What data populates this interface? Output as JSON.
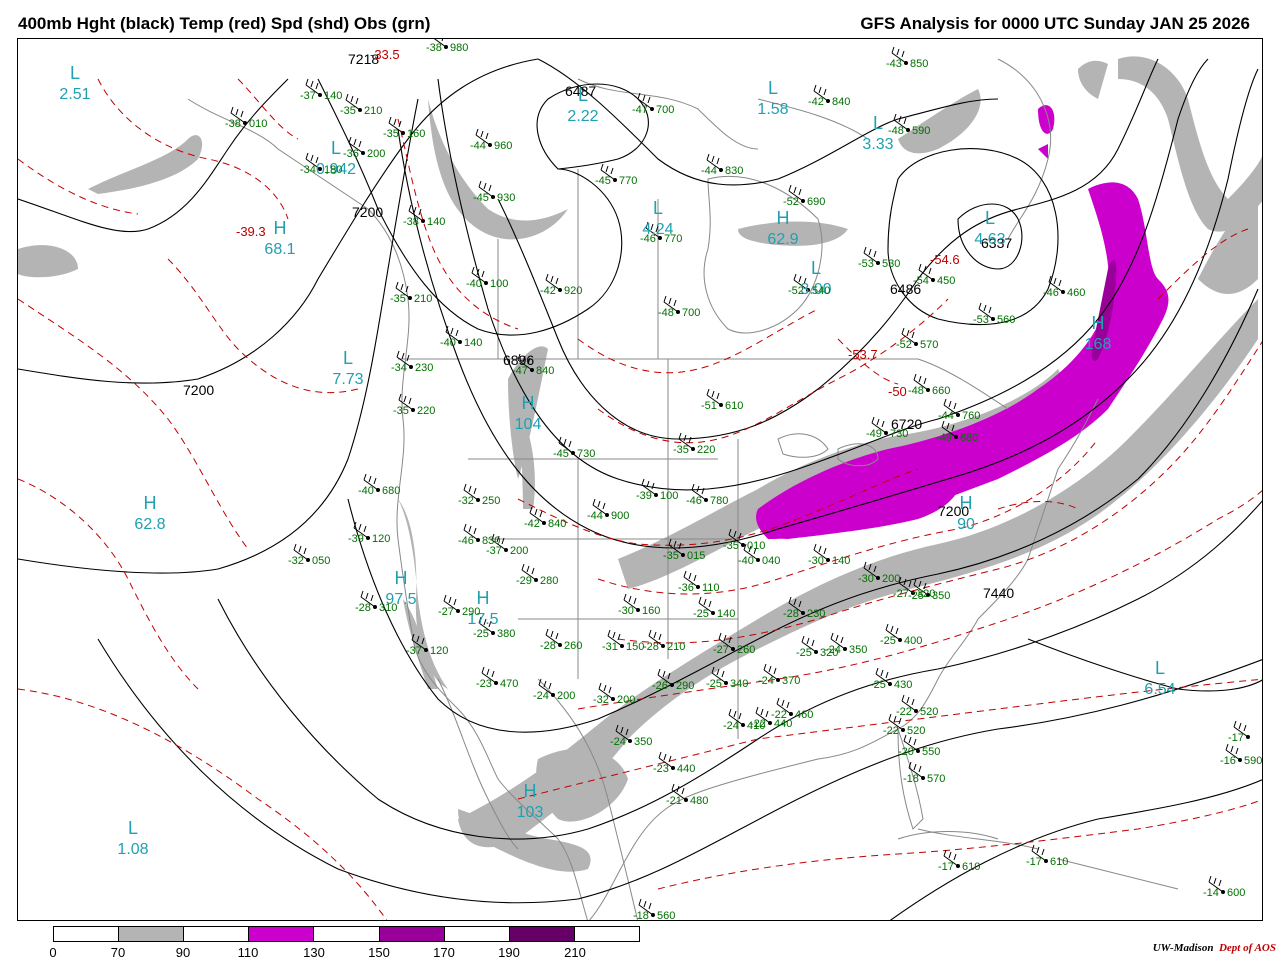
{
  "header": {
    "title_left": "400mb Hght (black) Temp (red) Spd (shd) Obs (grn)",
    "title_right": "GFS Analysis for 0000 UTC Sunday  JAN 25 2026"
  },
  "colors": {
    "height": "#000000",
    "temperature": "#c00000",
    "observation": "#007000",
    "center": "#20a0b0",
    "speed_70": "#b4b4b4",
    "speed_110": "#cc00cc",
    "speed_150": "#990099",
    "speed_190": "#660066",
    "map_lines": "#888888"
  },
  "height_labels": [
    "7218",
    "6487",
    "7200",
    "7200",
    "6896",
    "6337",
    "6486",
    "6720",
    "7200",
    "7440"
  ],
  "temperature_labels": [
    "-33.5",
    "-39.3",
    "-54.6",
    "-53.7",
    "-50"
  ],
  "centers": [
    {
      "type": "L",
      "value": "2.51"
    },
    {
      "type": "L",
      "value": "2.22"
    },
    {
      "type": "H",
      "value": ""
    },
    {
      "type": "L",
      "value": "1.58"
    },
    {
      "type": "L",
      "value": "3.33"
    },
    {
      "type": "L",
      "value": "0.942"
    },
    {
      "type": "H",
      "value": "68.1"
    },
    {
      "type": "L",
      "value": "4.24"
    },
    {
      "type": "H",
      "value": "62.9"
    },
    {
      "type": "L",
      "value": "4.63"
    },
    {
      "type": "L",
      "value": "3.00"
    },
    {
      "type": "L",
      "value": "7.73"
    },
    {
      "type": "H",
      "value": "104"
    },
    {
      "type": "H",
      "value": "168"
    },
    {
      "type": "H",
      "value": "62.8"
    },
    {
      "type": "H",
      "value": "90"
    },
    {
      "type": "H",
      "value": "97.5"
    },
    {
      "type": "H",
      "value": "17.5"
    },
    {
      "type": "L",
      "value": "6.54"
    },
    {
      "type": "H",
      "value": "103"
    },
    {
      "type": "L",
      "value": "1.08"
    }
  ],
  "observations": [
    {
      "t": "-38",
      "h": "980"
    },
    {
      "t": "-37",
      "h": "140"
    },
    {
      "t": "-35",
      "h": "210"
    },
    {
      "t": "-38",
      "h": "010"
    },
    {
      "t": "-35",
      "h": "160"
    },
    {
      "t": "-36",
      "h": "200"
    },
    {
      "t": "-34",
      "h": "180"
    },
    {
      "t": "-44",
      "h": "960"
    },
    {
      "t": "-45",
      "h": "770"
    },
    {
      "t": "-43",
      "h": "850"
    },
    {
      "t": "-42",
      "h": "840"
    },
    {
      "t": "-48",
      "h": "590"
    },
    {
      "t": "-44",
      "h": "830"
    },
    {
      "t": "-47",
      "h": "700"
    },
    {
      "t": "-38",
      "h": "140"
    },
    {
      "t": "-45",
      "h": "930"
    },
    {
      "t": "-46",
      "h": "770"
    },
    {
      "t": "-52",
      "h": "690"
    },
    {
      "t": "-53",
      "h": "530"
    },
    {
      "t": "-54",
      "h": "450"
    },
    {
      "t": "-40",
      "h": "100"
    },
    {
      "t": "-42",
      "h": "920"
    },
    {
      "t": "-52",
      "h": "540"
    },
    {
      "t": "-46",
      "h": "460"
    },
    {
      "t": "-35",
      "h": "210"
    },
    {
      "t": "-48",
      "h": "700"
    },
    {
      "t": "-53",
      "h": "560"
    },
    {
      "t": "-40",
      "h": "140"
    },
    {
      "t": "-52",
      "h": "570"
    },
    {
      "t": "-34",
      "h": "230"
    },
    {
      "t": "-47",
      "h": "840"
    },
    {
      "t": "-48",
      "h": "660"
    },
    {
      "t": "-35",
      "h": "220"
    },
    {
      "t": "-51",
      "h": "610"
    },
    {
      "t": "-45",
      "h": "730"
    },
    {
      "t": "-35",
      "h": "220"
    },
    {
      "t": "-49",
      "h": "730"
    },
    {
      "t": "-49",
      "h": "680"
    },
    {
      "t": "-44",
      "h": "760"
    },
    {
      "t": "-40",
      "h": "680"
    },
    {
      "t": "-32",
      "h": "250"
    },
    {
      "t": "-39",
      "h": "100"
    },
    {
      "t": "-46",
      "h": "780"
    },
    {
      "t": "-42",
      "h": "840"
    },
    {
      "t": "-44",
      "h": "900"
    },
    {
      "t": "-46",
      "h": "830"
    },
    {
      "t": "-39",
      "h": "120"
    },
    {
      "t": "-37",
      "h": "200"
    },
    {
      "t": "-35",
      "h": "015"
    },
    {
      "t": "-35",
      "h": "010"
    },
    {
      "t": "-32",
      "h": "050"
    },
    {
      "t": "-29",
      "h": "280"
    },
    {
      "t": "-40",
      "h": "040"
    },
    {
      "t": "-30",
      "h": "140"
    },
    {
      "t": "-30",
      "h": "200"
    },
    {
      "t": "-28",
      "h": "310"
    },
    {
      "t": "-27",
      "h": "290"
    },
    {
      "t": "-36",
      "h": "110"
    },
    {
      "t": "-30",
      "h": "160"
    },
    {
      "t": "-25",
      "h": "140"
    },
    {
      "t": "-28",
      "h": "230"
    },
    {
      "t": "-27",
      "h": "320"
    },
    {
      "t": "-25",
      "h": "350"
    },
    {
      "t": "-25",
      "h": "380"
    },
    {
      "t": "-37",
      "h": "120"
    },
    {
      "t": "-28",
      "h": "260"
    },
    {
      "t": "-31",
      "h": "150"
    },
    {
      "t": "-28",
      "h": "210"
    },
    {
      "t": "-27",
      "h": "260"
    },
    {
      "t": "-25",
      "h": "320"
    },
    {
      "t": "-24",
      "h": "350"
    },
    {
      "t": "-25",
      "h": "400"
    },
    {
      "t": "-25",
      "h": "430"
    },
    {
      "t": "-23",
      "h": "470"
    },
    {
      "t": "-24",
      "h": "200"
    },
    {
      "t": "-32",
      "h": "200"
    },
    {
      "t": "-26",
      "h": "290"
    },
    {
      "t": "-25",
      "h": "340"
    },
    {
      "t": "-24",
      "h": "370"
    },
    {
      "t": "-24",
      "h": "410"
    },
    {
      "t": "-22",
      "h": "520"
    },
    {
      "t": "-22",
      "h": "440"
    },
    {
      "t": "-22",
      "h": "460"
    },
    {
      "t": "-24",
      "h": "350"
    },
    {
      "t": "-22",
      "h": "520"
    },
    {
      "t": "-20",
      "h": "550"
    },
    {
      "t": "-17",
      "h": ""
    },
    {
      "t": "-23",
      "h": "440"
    },
    {
      "t": "-16",
      "h": "590"
    },
    {
      "t": "-18",
      "h": "570"
    },
    {
      "t": "-21",
      "h": "480"
    },
    {
      "t": "-17",
      "h": "610"
    },
    {
      "t": "-17",
      "h": "610"
    },
    {
      "t": "-14",
      "h": "600"
    },
    {
      "t": "-18",
      "h": "560"
    }
  ],
  "legend": {
    "ticks": [
      "0",
      "70",
      "90",
      "110",
      "130",
      "150",
      "170",
      "190",
      "210"
    ]
  },
  "footer": {
    "credit_a": "UW-Madison",
    "credit_b": "Dept of AOS"
  }
}
